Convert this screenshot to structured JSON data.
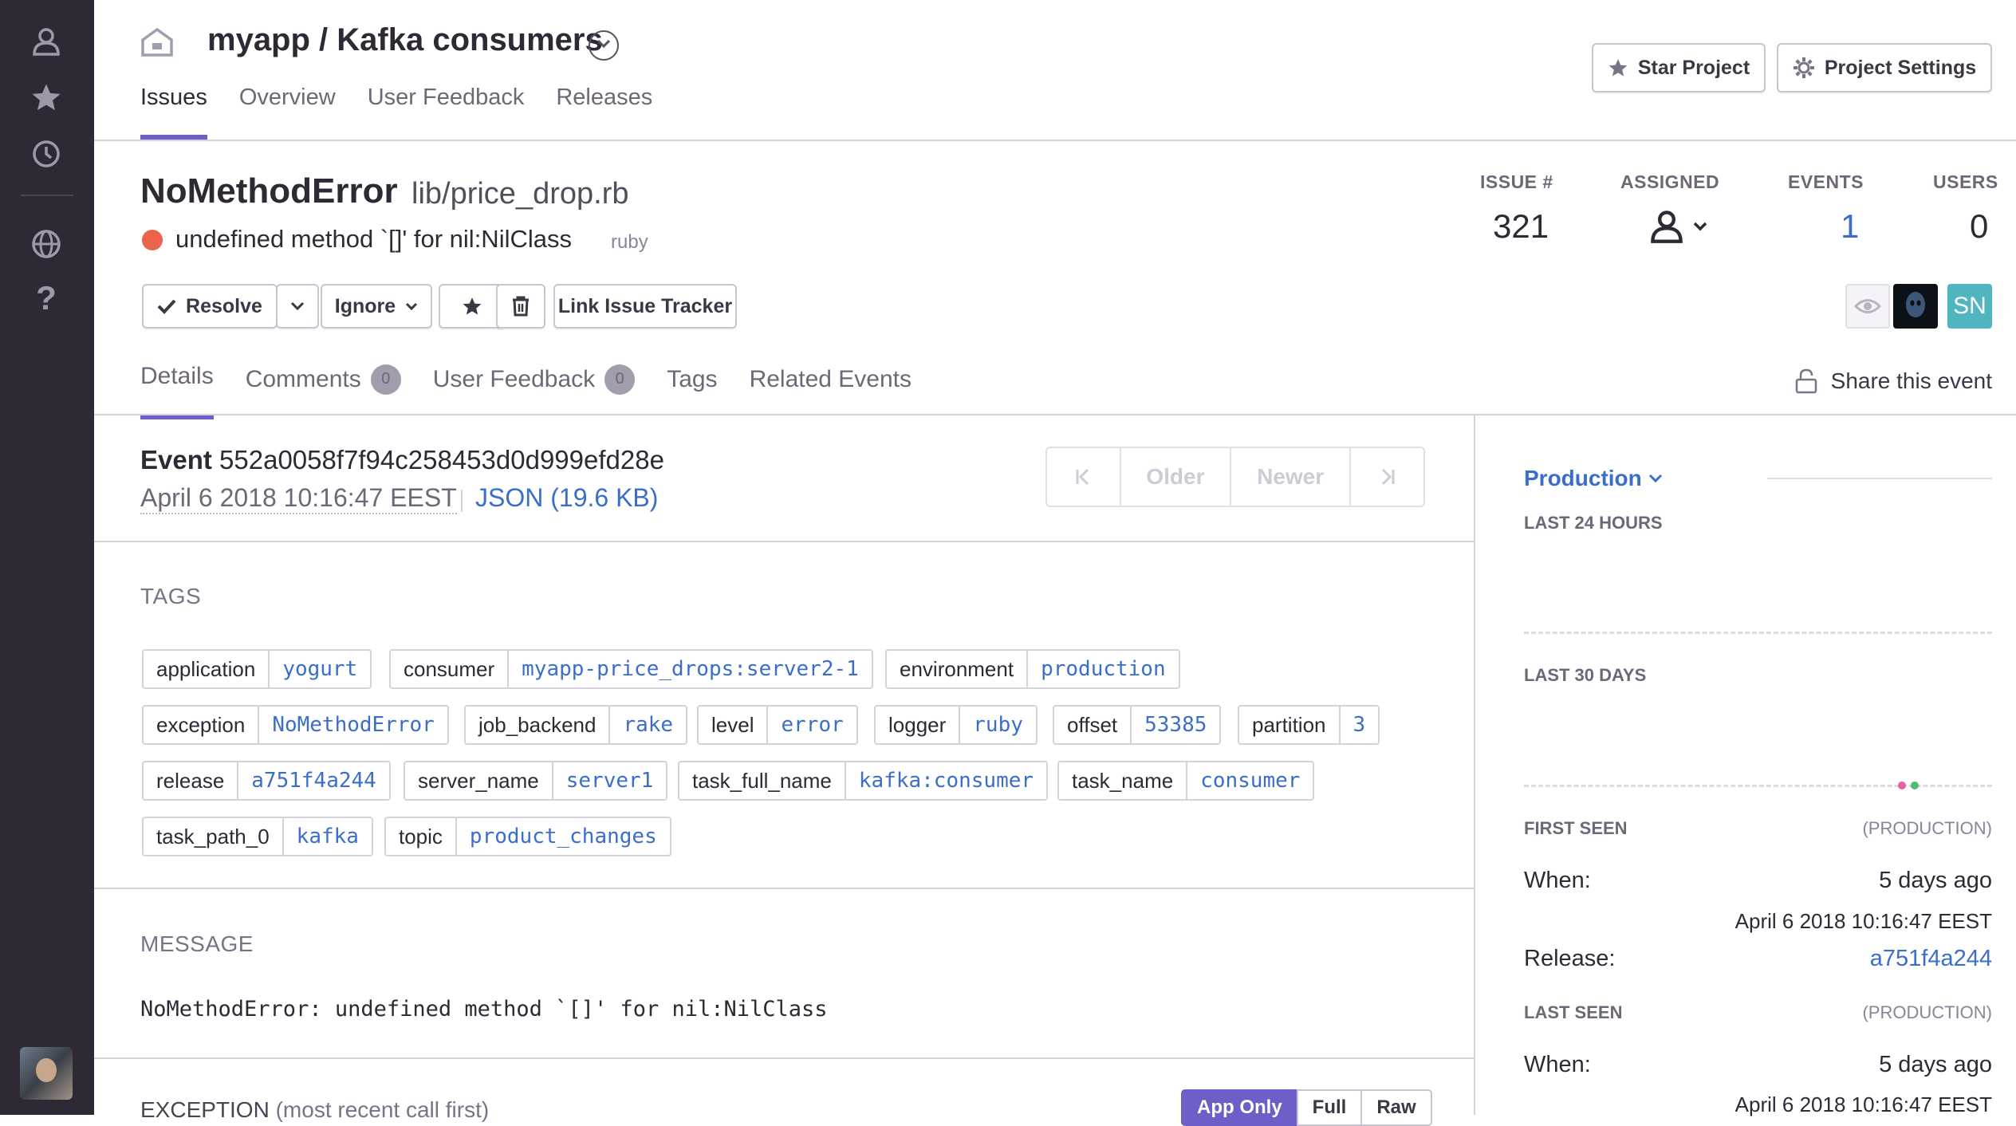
{
  "project": {
    "title": "myapp / Kafka consumers"
  },
  "nav": {
    "tabs": [
      "Issues",
      "Overview",
      "User Feedback",
      "Releases"
    ]
  },
  "header_buttons": {
    "star": "Star Project",
    "settings": "Project Settings"
  },
  "issue": {
    "title": "NoMethodError",
    "culprit": "lib/price_drop.rb",
    "message": "undefined method `[]' for nil:NilClass",
    "platform": "ruby",
    "level_color": "#e9644b"
  },
  "stats": {
    "issue_label": "ISSUE #",
    "issue_value": "321",
    "assigned_label": "ASSIGNED",
    "events_label": "EVENTS",
    "events_value": "1",
    "users_label": "USERS",
    "users_value": "0"
  },
  "actions": {
    "resolve": "Resolve",
    "ignore": "Ignore",
    "link_tracker": "Link Issue Tracker"
  },
  "participants": {
    "initials": "SN"
  },
  "detail_tabs": {
    "details": "Details",
    "comments": "Comments",
    "comments_count": "0",
    "user_feedback": "User Feedback",
    "user_feedback_count": "0",
    "tags": "Tags",
    "related": "Related Events"
  },
  "share": "Share this event",
  "event": {
    "label": "Event",
    "id": "552a0058f7f94c258453d0d999efd28e",
    "date": "April 6 2018 10:16:47 EEST",
    "json": "JSON (19.6 KB)"
  },
  "pager": {
    "older": "Older",
    "newer": "Newer"
  },
  "tags_title": "TAGS",
  "tags": [
    {
      "k": "application",
      "v": "yogurt"
    },
    {
      "k": "consumer",
      "v": "myapp-price_drops:server2-1"
    },
    {
      "k": "environment",
      "v": "production"
    },
    {
      "k": "exception",
      "v": "NoMethodError"
    },
    {
      "k": "job_backend",
      "v": "rake"
    },
    {
      "k": "level",
      "v": "error"
    },
    {
      "k": "logger",
      "v": "ruby"
    },
    {
      "k": "offset",
      "v": "53385"
    },
    {
      "k": "partition",
      "v": "3"
    },
    {
      "k": "release",
      "v": "a751f4a244"
    },
    {
      "k": "server_name",
      "v": "server1"
    },
    {
      "k": "task_full_name",
      "v": "kafka:consumer"
    },
    {
      "k": "task_name",
      "v": "consumer"
    },
    {
      "k": "task_path_0",
      "v": "kafka"
    },
    {
      "k": "topic",
      "v": "product_changes"
    }
  ],
  "message_title": "MESSAGE",
  "message_body": "NoMethodError: undefined method `[]' for nil:NilClass",
  "exception_title": "EXCEPTION",
  "exception_sub": "(most recent call first)",
  "exception_toggle": [
    "App Only",
    "Full",
    "Raw"
  ],
  "sidebar": {
    "environment": "Production",
    "last24": "LAST 24 HOURS",
    "last30": "LAST 30 DAYS",
    "first_seen": "FIRST SEEN",
    "last_seen": "LAST SEEN",
    "env_note": "(PRODUCTION)",
    "when_label": "When:",
    "release_label": "Release:",
    "first_when": "5 days ago",
    "first_date": "April 6 2018 10:16:47 EEST",
    "first_release": "a751f4a244",
    "last_when": "5 days ago",
    "last_date": "April 6 2018 10:16:47 EEST"
  },
  "colors": {
    "accent": "#6c5fc7",
    "link": "#3b6ecc",
    "sidebar": "#2f2936"
  }
}
